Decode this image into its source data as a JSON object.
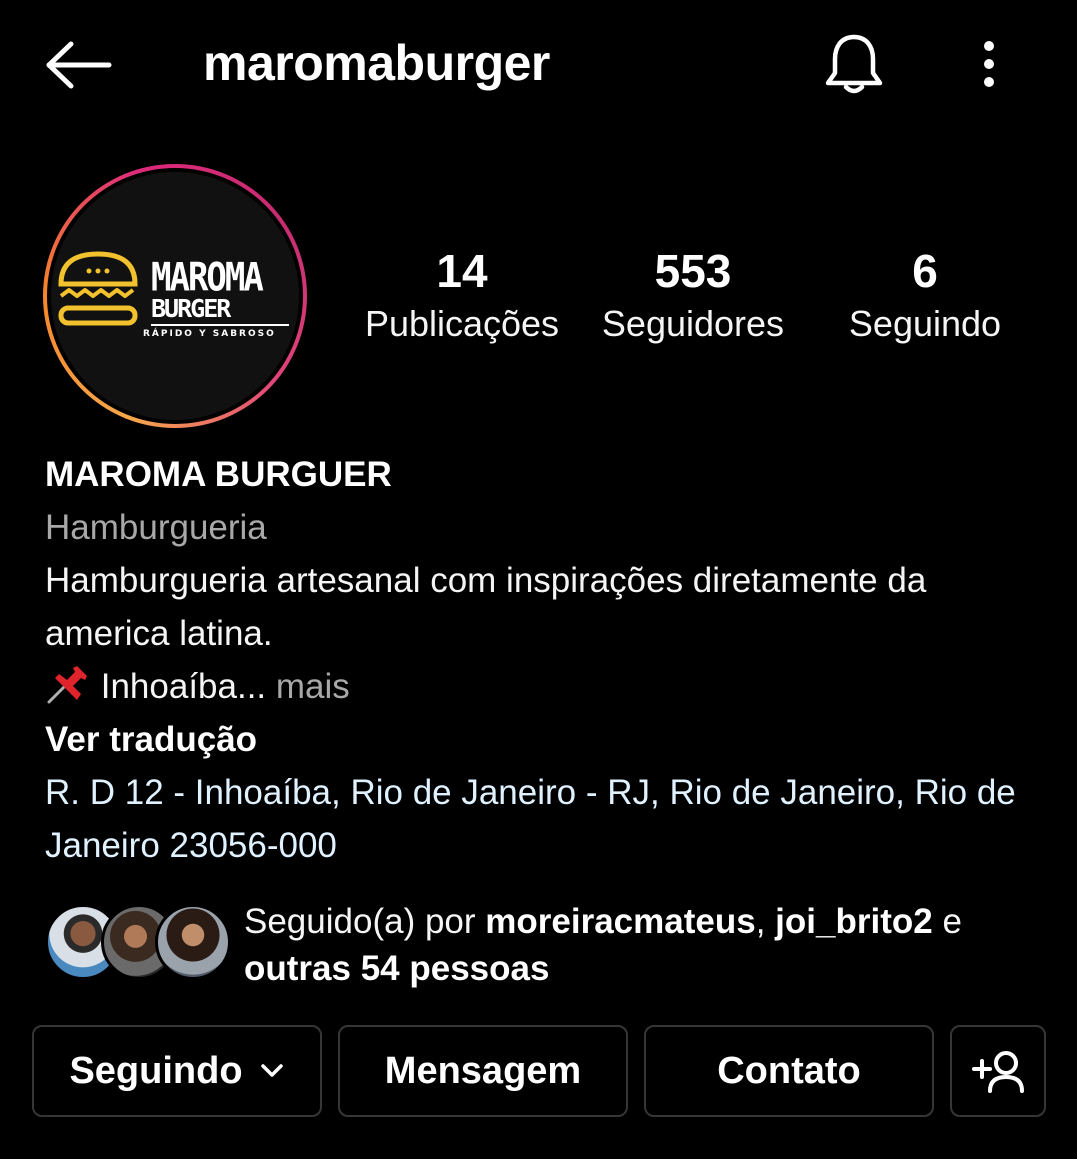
{
  "header": {
    "username": "maromaburger"
  },
  "profile": {
    "logo_text_line1": "MAROMA",
    "logo_text_line2": "BURGER",
    "logo_tagline": "RÁPIDO Y SABROSO",
    "stats": [
      {
        "value": "14",
        "label": "Publicações"
      },
      {
        "value": "553",
        "label": "Seguidores"
      },
      {
        "value": "6",
        "label": "Seguindo"
      }
    ]
  },
  "bio": {
    "name": "MAROMA BURGUER",
    "category": "Hamburgueria",
    "description": "Hamburgueria artesanal com inspirações diretamente da america latina.",
    "pin_line": "Inhoaíba...",
    "more": "mais",
    "translate": "Ver tradução",
    "address": "R. D 12 - Inhoaíba, Rio de Janeiro - RJ, Rio de Janeiro, Rio de Janeiro 23056-000"
  },
  "followed_by": {
    "prefix": "Seguido(a) por",
    "user1": "moreiracmateus",
    "separator": ",",
    "user2": "joi_brito2",
    "conj": "e",
    "others": "outras 54 pessoas"
  },
  "actions": {
    "following": "Seguindo",
    "message": "Mensagem",
    "contact": "Contato"
  },
  "icons": {
    "back": "arrow-left-icon",
    "notifications": "bell-icon",
    "menu": "more-vertical-icon",
    "dropdown": "chevron-down-icon",
    "suggest": "add-person-icon",
    "pin": "pushpin-icon"
  },
  "colors": {
    "background": "#000000",
    "text": "#f5f5f5",
    "secondary_text": "#a8a8a8",
    "link_text": "#e0f1ff",
    "button_border": "#363636",
    "logo_yellow": "#f2c12e",
    "ring_start": "#f58529",
    "ring_end": "#dd2a7b"
  }
}
